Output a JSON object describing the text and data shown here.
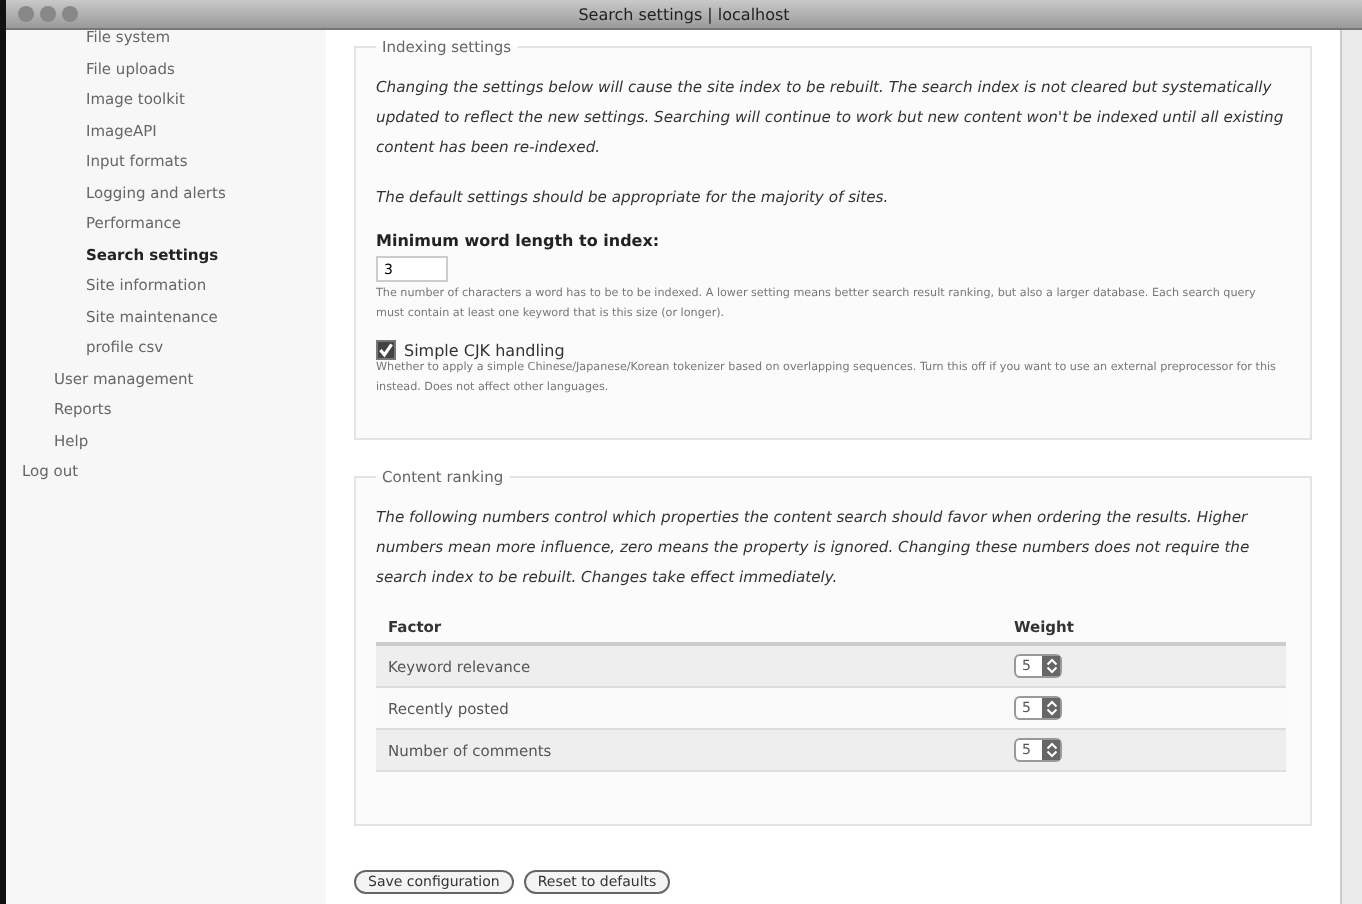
{
  "window": {
    "title": "Search settings | localhost"
  },
  "sidebar": {
    "items": [
      {
        "children": [
          {
            "children": [
              {
                "label": "File system",
                "selected": false
              },
              {
                "label": "File uploads",
                "selected": false
              },
              {
                "label": "Image toolkit",
                "selected": false
              },
              {
                "label": "ImageAPI",
                "selected": false
              },
              {
                "label": "Input formats",
                "selected": false
              },
              {
                "label": "Logging and alerts",
                "selected": false
              },
              {
                "label": "Performance",
                "selected": false
              },
              {
                "label": "Search settings",
                "selected": true
              },
              {
                "label": "Site information",
                "selected": false
              },
              {
                "label": "Site maintenance",
                "selected": false
              },
              {
                "label": "profile csv",
                "selected": false
              }
            ]
          },
          {
            "label": "User management",
            "selected": false
          },
          {
            "label": "Reports",
            "selected": false
          },
          {
            "label": "Help",
            "selected": false
          }
        ]
      },
      {
        "label": "Log out",
        "selected": false
      }
    ]
  },
  "indexing": {
    "legend": "Indexing settings",
    "paragraphs": [
      "Changing the settings below will cause the site index to be rebuilt. The search index is not cleared but systematically updated to reflect the new settings. Searching will continue to work but new content won't be indexed until all existing content has been re-indexed.",
      "The default settings should be appropriate for the majority of sites."
    ],
    "min_length": {
      "label": "Minimum word length to index:",
      "value": "3",
      "description": "The number of characters a word has to be to be indexed. A lower setting means better search result ranking, but also a larger database. Each search query must contain at least one keyword that is this size (or longer)."
    },
    "cjk": {
      "label": "Simple CJK handling",
      "checked": true,
      "description": "Whether to apply a simple Chinese/Japanese/Korean tokenizer based on overlapping sequences. Turn this off if you want to use an external preprocessor for this instead. Does not affect other languages."
    }
  },
  "ranking": {
    "legend": "Content ranking",
    "description": "The following numbers control which properties the content search should favor when ordering the results. Higher numbers mean more influence, zero means the property is ignored. Changing these numbers does not require the search index to be rebuilt. Changes take effect immediately.",
    "columns": [
      "Factor",
      "Weight"
    ],
    "rows": [
      {
        "factor": "Keyword relevance",
        "weight": "5"
      },
      {
        "factor": "Recently posted",
        "weight": "5"
      },
      {
        "factor": "Number of comments",
        "weight": "5"
      }
    ]
  },
  "buttons": [
    "Save configuration",
    "Reset to defaults"
  ]
}
